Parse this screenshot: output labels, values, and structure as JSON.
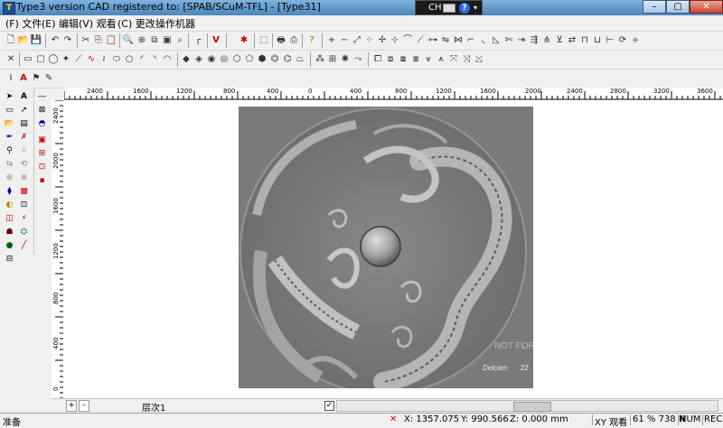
{
  "window": {
    "title": "Type3  version  CAD registered to: [SPAB/SCuM-TFL]  - [Type31]",
    "app_icon_letter": "T"
  },
  "language_bar": {
    "label": "CH",
    "help": "?"
  },
  "window_controls": {
    "minimize": "–",
    "maximize": "▢",
    "close": "✕"
  },
  "menu": [
    {
      "label": "(F) 文件"
    },
    {
      "label": "(E) 编辑"
    },
    {
      "label": "(V) 观看"
    },
    {
      "label": "(C) 更改"
    },
    {
      "label": "操作机器"
    }
  ],
  "mdi_controls": {
    "minimize": "_",
    "restore": "❐",
    "close": "✕"
  },
  "ruler_top_labels": [
    "2400",
    "1600",
    "1200",
    "800",
    "400",
    "0",
    "400",
    "800",
    "1200",
    "1600",
    "2000",
    "2400",
    "2800",
    "3200",
    "3600"
  ],
  "ruler_left_labels": [
    "2400",
    "2000",
    "1600",
    "1200",
    "800",
    "400",
    "0"
  ],
  "canvas": {
    "image_overlay_1": "NOT FOR",
    "image_overlay_2": "Delcam",
    "image_overlay_3": "22"
  },
  "layer_bar": {
    "add": "+",
    "remove": "-",
    "tab_label": "层次1",
    "checkbox": "✓"
  },
  "status": {
    "left_text": "准备",
    "x": "X: 1357.075",
    "y": "Y: 990.566",
    "z": "Z: 0.000 mm",
    "view": "XY 观看",
    "zoom": "61 % 738 N",
    "num": "NUM",
    "rec": "REC"
  },
  "colors": {
    "titlebar": "#4b86bd",
    "image_bg": "#7c7c7c",
    "status_x_icon": "#d00000"
  }
}
